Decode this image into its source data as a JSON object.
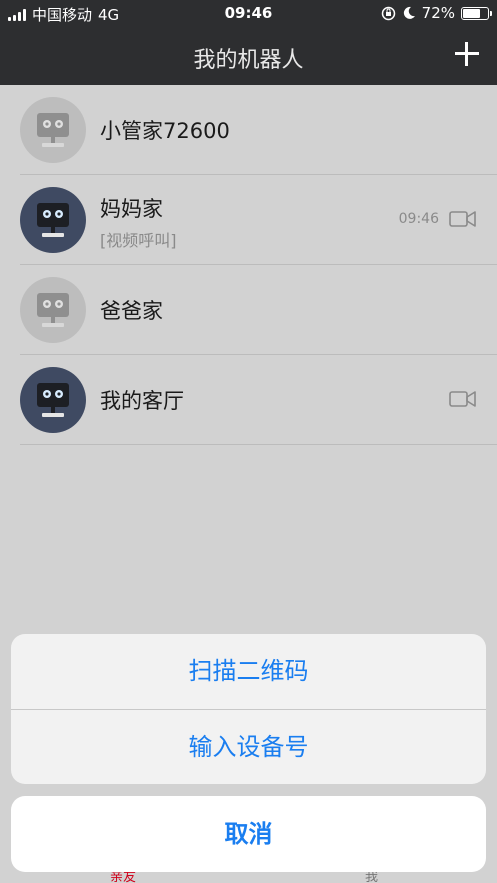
{
  "status_bar": {
    "carrier": "中国移动",
    "network": "4G",
    "time": "09:46",
    "battery": "72%",
    "battery_level": 0.72
  },
  "nav": {
    "title": "我的机器人",
    "add_icon": "plus-icon"
  },
  "robots": [
    {
      "name": "小管家72600",
      "status": "offline",
      "sub": "",
      "time": "",
      "video": false
    },
    {
      "name": "妈妈家",
      "status": "online",
      "sub": "[视频呼叫]",
      "time": "09:46",
      "video": true
    },
    {
      "name": "爸爸家",
      "status": "offline",
      "sub": "",
      "time": "",
      "video": false
    },
    {
      "name": "我的客厅",
      "status": "online",
      "sub": "",
      "time": "",
      "video": true
    }
  ],
  "action_sheet": {
    "options": [
      "扫描二维码",
      "输入设备号"
    ],
    "cancel": "取消"
  },
  "tab_bar": {
    "tabs": [
      "亲友",
      "我"
    ],
    "active_color": "#d0021b"
  },
  "colors": {
    "accent": "#1a7ef0",
    "nav_bg": "#2d2e30"
  }
}
